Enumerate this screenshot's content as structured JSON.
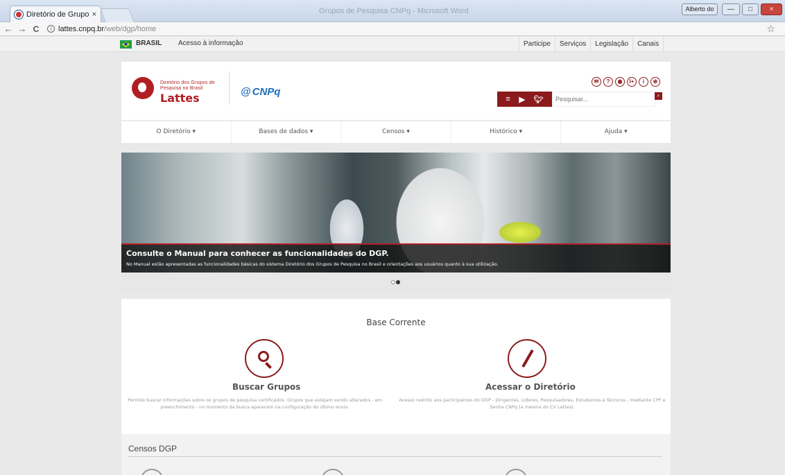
{
  "browser": {
    "tab_title": "Diretório de Grupos de P",
    "tab_close": "×",
    "window_title": "Grupos de Pesquisa CNPq - Microsoft Word",
    "user_pill": "Alberto do Valle",
    "min_btn": "—",
    "max_btn": "□",
    "close_btn": "×",
    "back": "←",
    "forward": "→",
    "reload": "C",
    "info": "i",
    "url_host": "lattes.cnpq.br",
    "url_path": "/web/dgp/home",
    "star": "☆"
  },
  "gov_bar": {
    "brasil": "BRASIL",
    "access": "Acesso à informação",
    "links": [
      "Participe",
      "Serviços",
      "Legislação",
      "Canais"
    ]
  },
  "header": {
    "logo_small": "Diretório dos Grupos de Pesquisa no Brasil",
    "logo_lattes": "Lattes",
    "cnpq": "CNPq",
    "cnpq_icon": "@",
    "accessibility_icons": [
      "✉",
      "?",
      "◉",
      "I+",
      "i",
      "⊕"
    ],
    "social": [
      "feed",
      "▶",
      "✓"
    ],
    "search_placeholder": "Pesquisar...",
    "search_btn": "⌕"
  },
  "menu": {
    "items": [
      "O Diretório ▾",
      "Bases de dados ▾",
      "Censos ▾",
      "Histórico ▾",
      "Ajuda ▾"
    ]
  },
  "banner": {
    "title": "Consulte o Manual para conhecer as funcionalidades do DGP.",
    "text": "No Manual estão apresentadas as funcionalidades básicas do sistema Diretório dos Grupos de Pesquisa no Brasil e orientações aos usuários quanto à sua utilização."
  },
  "base": {
    "title": "Base Corrente",
    "buscar_title": "Buscar Grupos",
    "buscar_desc": "Permite buscar informações sobre os grupos de pesquisa certificados. Grupos que estejam sendo alterados - em preenchimento - no momento da busca aparecem na configuração do último envio.",
    "acessar_title": "Acessar o Diretório",
    "acessar_desc": "Acesso restrito aos participantes do DGP - Dirigentes, Líderes, Pesquisadores, Estudantes e Técnicos - mediante CPF e Senha CNPq (a mesma do CV Lattes)."
  },
  "censos": {
    "title": "Censos DGP"
  },
  "colors": {
    "brand_red": "#8b1a1c",
    "cnpq_blue": "#1d6fb8"
  }
}
